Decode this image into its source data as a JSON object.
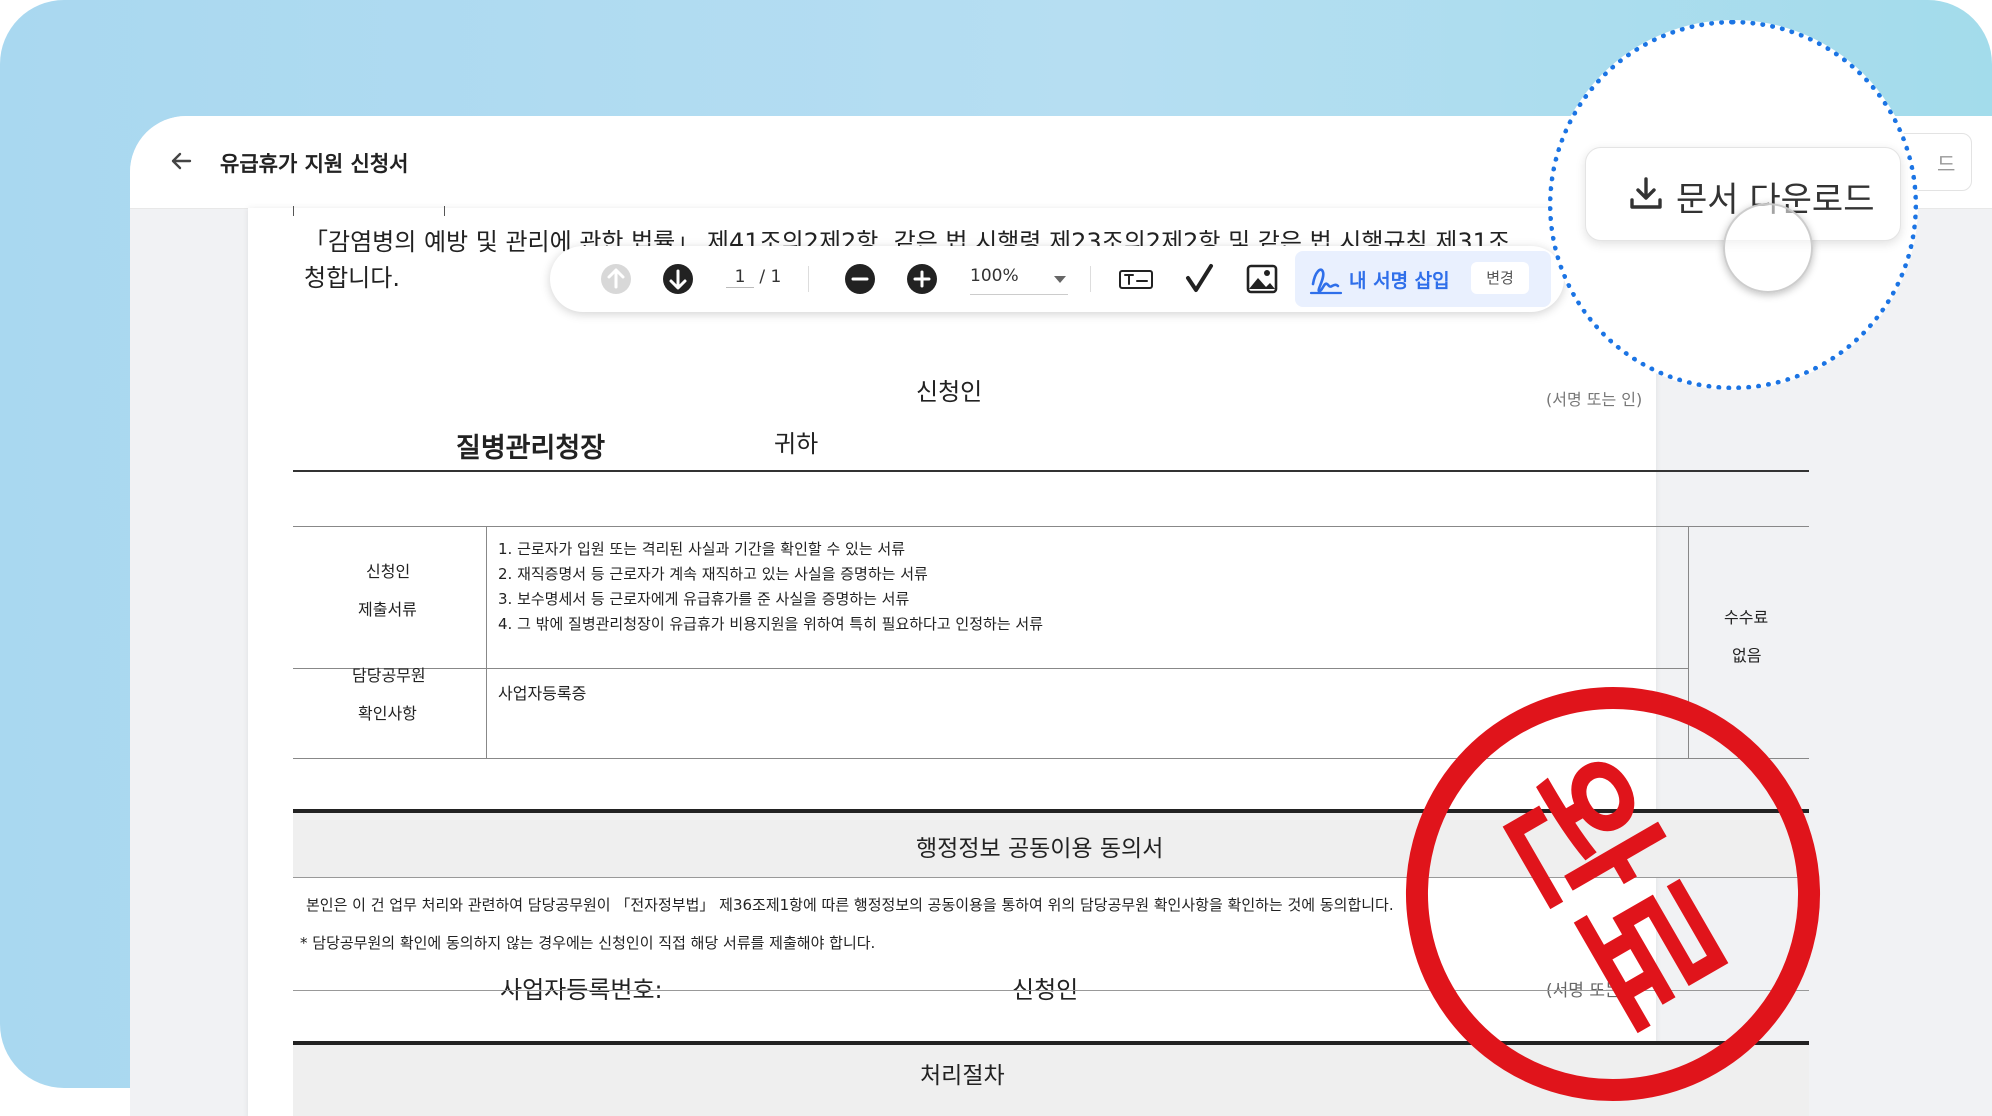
{
  "header": {
    "title": "유급휴가 지원 신청서",
    "download_label_partial": "드"
  },
  "document": {
    "intro_line1": "「감염병의 예방 및 관리에 관한 법률」 제41조의2제2항, 같은 법 시행령 제23조의2제2항 및 같은 법 시행규칙 제31조",
    "intro_line2": "청합니다.",
    "applicant_label": "신청인",
    "addressee": "질병관리청장",
    "addressee_suffix": "귀하",
    "sign_note": "(서명 또는 인)",
    "table": {
      "row1_label_a": "신청인",
      "row1_label_b": "제출서류",
      "row1_items": [
        "1. 근로자가 입원 또는 격리된 사실과 기간을 확인할 수 있는 서류",
        "2. 재직증명서 등 근로자가 계속 재직하고 있는 사실을 증명하는 서류",
        "3. 보수명세서 등 근로자에게 유급휴가를 준 사실을 증명하는 서류",
        "4. 그 밖에 질병관리청장이 유급휴가 비용지원을 위하여 특히 필요하다고 인정하는 서류"
      ],
      "row2_label_a": "담당공무원",
      "row2_label_b": "확인사항",
      "row2_value": "사업자등록증",
      "fee_label": "수수료",
      "fee_value": "없음"
    },
    "consent": {
      "title": "행정정보 공동이용 동의서",
      "body": "본인은 이 건 업무 처리와 관련하여 담당공무원이 「전자정부법」 제36조제1항에 따른 행정정보의 공동이용을 통하여 위의 담당공무원 확인사항을 확인하는 것에 동의합니다.",
      "note": "* 담당공무원의 확인에 동의하지 않는 경우에는 신청인이 직접 해당 서류를 제출해야 합니다.",
      "biz_no_label": "사업자등록번호:",
      "applicant_label": "신청인",
      "sign_note": "(서명 또는"
    },
    "procedure_title": "처리절차"
  },
  "toolbar": {
    "page_current": "1",
    "page_total": "/ 1",
    "zoom": "100%",
    "insert_signature": "내 서명 삽입",
    "change": "변경"
  },
  "callout": {
    "download_label": "문서 다운로드"
  },
  "stamp": {
    "text": "완료"
  },
  "colors": {
    "accent": "#2f6fea",
    "callout_border": "#1b74e4",
    "stamp": "#e0141b"
  },
  "icons": [
    "back-arrow-icon",
    "page-up-icon",
    "page-down-icon",
    "zoom-out-icon",
    "zoom-in-icon",
    "text-field-icon",
    "checkmark-icon",
    "image-icon",
    "signature-icon",
    "download-icon"
  ]
}
